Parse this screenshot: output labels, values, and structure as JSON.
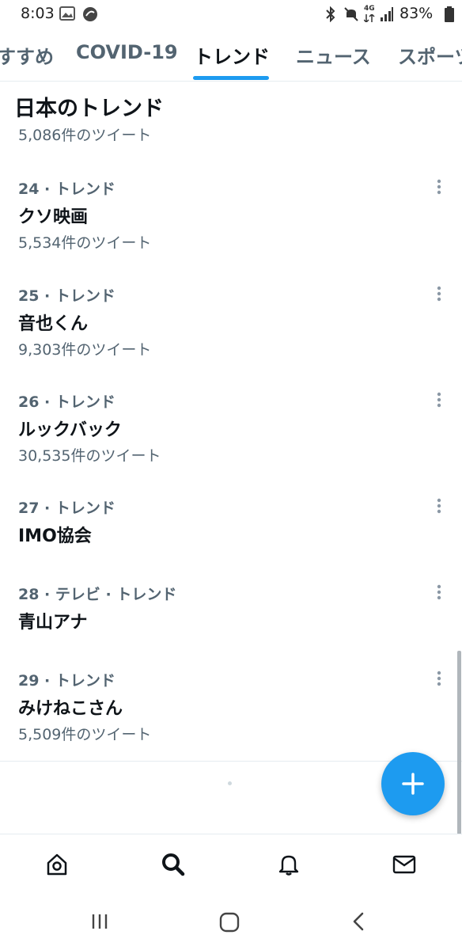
{
  "status_bar": {
    "time": "8:03",
    "battery": "83%",
    "network": "4G"
  },
  "tabs": [
    {
      "label": "すすめ",
      "active": false
    },
    {
      "label": "COVID-19",
      "active": false
    },
    {
      "label": "トレンド",
      "active": true
    },
    {
      "label": "ニュース",
      "active": false
    },
    {
      "label": "スポーツ",
      "active": false
    }
  ],
  "section": {
    "title": "日本のトレンド",
    "partial_count": "5,086件のツイート"
  },
  "trends": [
    {
      "meta": "24 · トレンド",
      "name": "クソ映画",
      "count": "5,534件のツイート"
    },
    {
      "meta": "25 · トレンド",
      "name": "音也くん",
      "count": "9,303件のツイート"
    },
    {
      "meta": "26 · トレンド",
      "name": "ルックバック",
      "count": "30,535件のツイート"
    },
    {
      "meta": "27 · トレンド",
      "name": "IMO協会",
      "count": ""
    },
    {
      "meta": "28 · テレビ · トレンド",
      "name": "青山アナ",
      "count": ""
    },
    {
      "meta": "29 · トレンド",
      "name": "みけねこさん",
      "count": "5,509件のツイート"
    }
  ],
  "colors": {
    "accent": "#1d9bf0",
    "primary_text": "#0f1419",
    "secondary_text": "#536471"
  },
  "icons": {
    "fab": "plus-icon",
    "bottom_nav": [
      "home-icon",
      "search-icon",
      "notifications-icon",
      "messages-icon"
    ],
    "system_nav": [
      "recents-icon",
      "home-button-icon",
      "back-icon"
    ]
  }
}
